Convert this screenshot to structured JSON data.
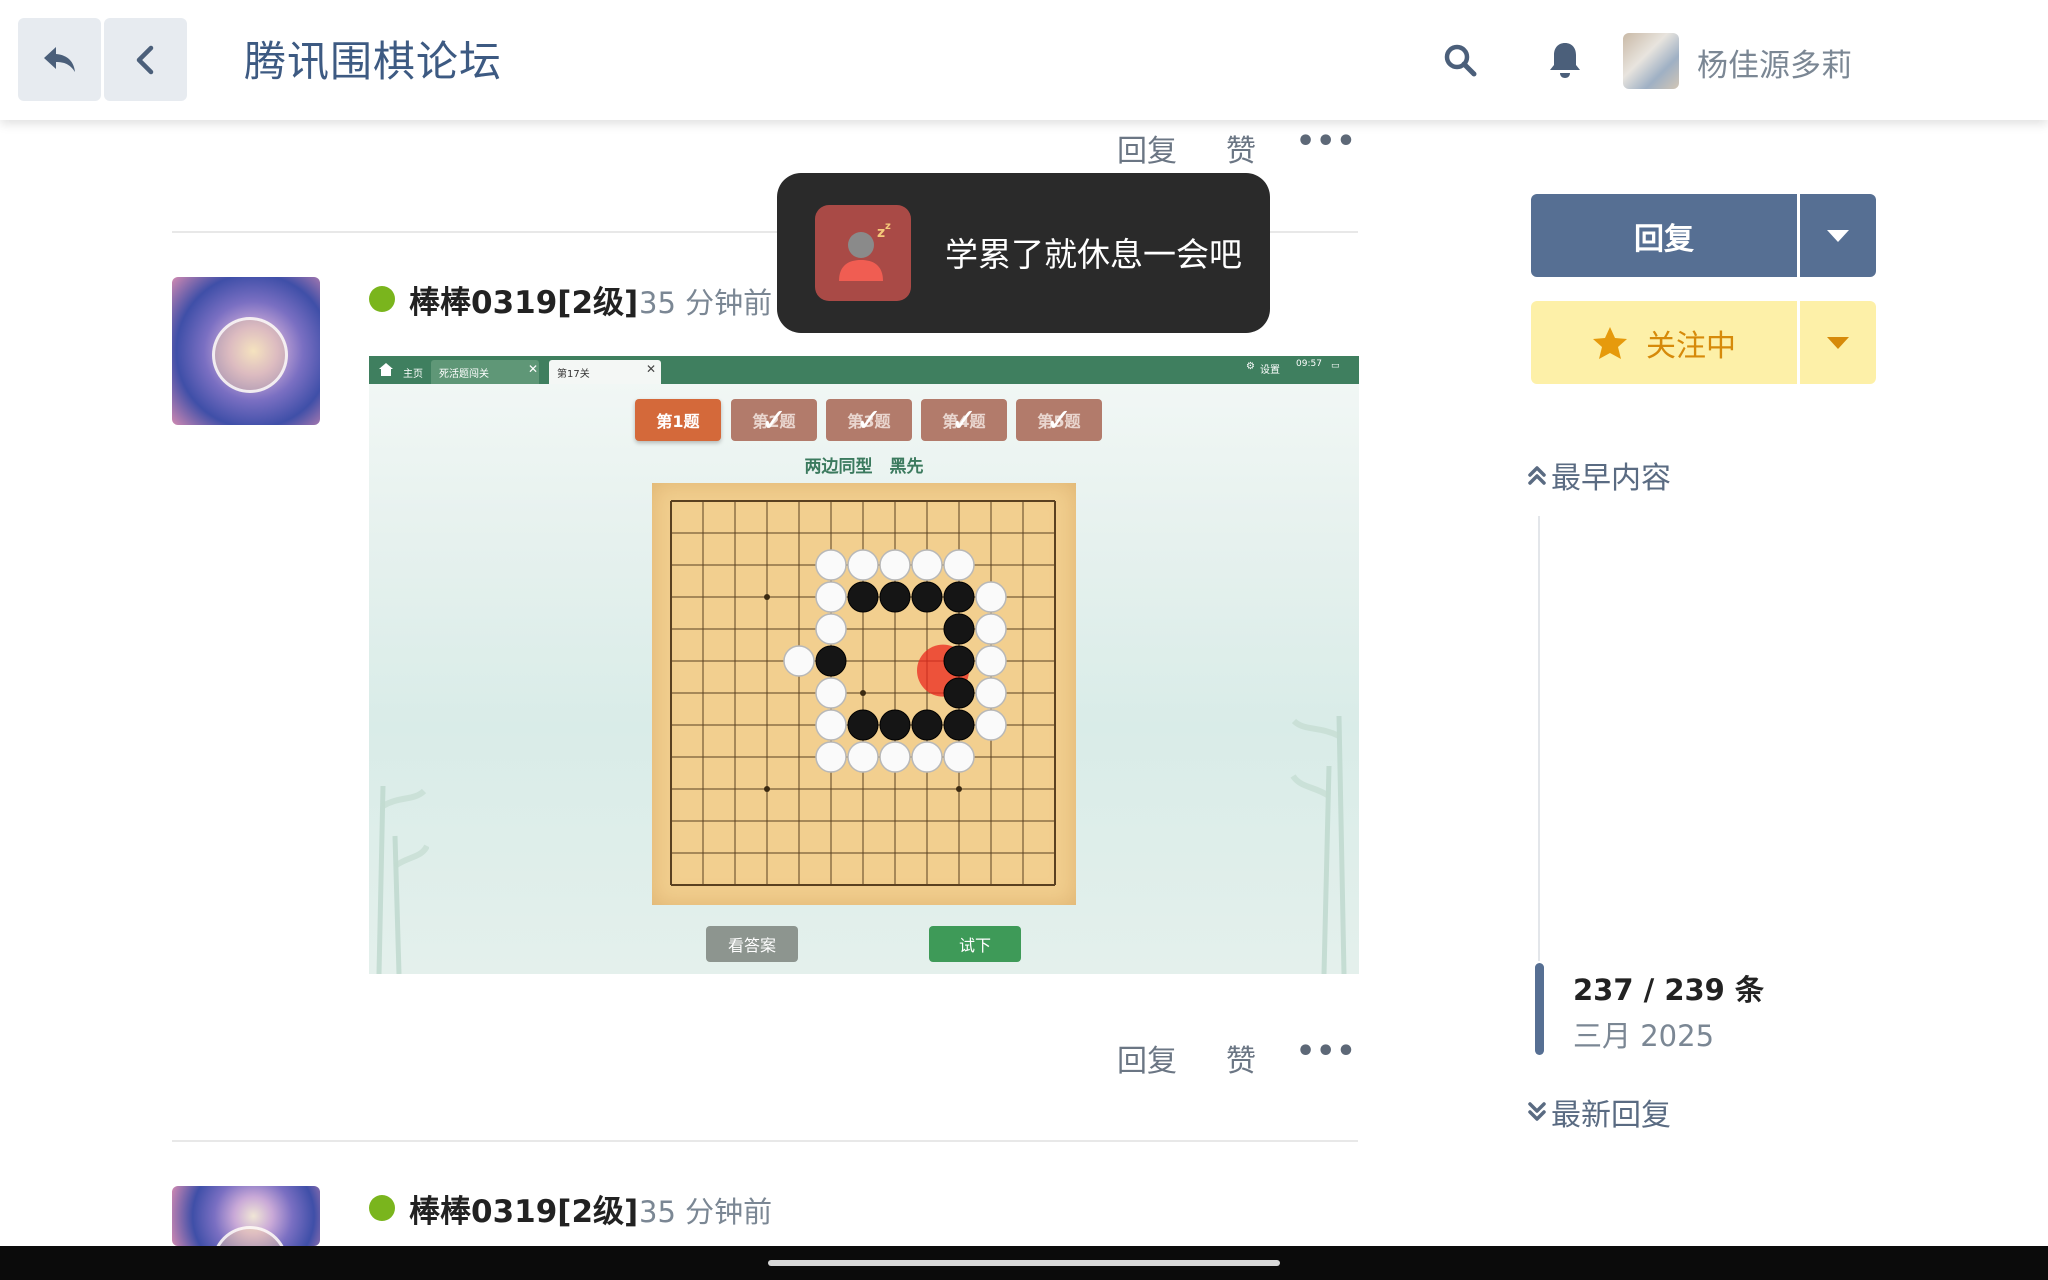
{
  "header": {
    "title": "腾讯围棋论坛",
    "username": "杨佳源多莉",
    "icons": {
      "back": "reply-arrow-icon",
      "prev": "chevron-left-icon",
      "search": "search-icon",
      "notifications": "bell-icon"
    }
  },
  "post_actions": {
    "reply": "回复",
    "like": "赞",
    "more": "•••"
  },
  "posts": [
    {
      "username": "棒棒0319[2级]",
      "time": "35 分钟前",
      "image": {
        "tabs": [
          "主页",
          "死活题闯关",
          "第17关"
        ],
        "settings": "设置",
        "clock": "09:57",
        "questions": [
          "第1题",
          "第2题",
          "第3题",
          "第4题",
          "第5题"
        ],
        "subtitle": "两边同型　黑先",
        "buttons": {
          "answer": "看答案",
          "try": "试下"
        },
        "stones": {
          "white": [
            [
              5,
              2
            ],
            [
              6,
              2
            ],
            [
              7,
              2
            ],
            [
              8,
              2
            ],
            [
              9,
              2
            ],
            [
              5,
              3
            ],
            [
              10,
              3
            ],
            [
              5,
              4
            ],
            [
              10,
              4
            ],
            [
              4,
              5
            ],
            [
              10,
              5
            ],
            [
              5,
              6
            ],
            [
              10,
              6
            ],
            [
              5,
              7
            ],
            [
              10,
              7
            ],
            [
              5,
              8
            ],
            [
              6,
              8
            ],
            [
              7,
              8
            ],
            [
              8,
              8
            ],
            [
              9,
              8
            ]
          ],
          "black": [
            [
              6,
              3
            ],
            [
              7,
              3
            ],
            [
              8,
              3
            ],
            [
              9,
              3
            ],
            [
              9,
              4
            ],
            [
              5,
              5
            ],
            [
              9,
              5
            ],
            [
              9,
              6
            ],
            [
              6,
              7
            ],
            [
              7,
              7
            ],
            [
              8,
              7
            ],
            [
              9,
              7
            ]
          ],
          "hint": [
            8.5,
            5.3
          ]
        }
      }
    },
    {
      "username": "棒棒0319[2级]",
      "time": "35 分钟前"
    }
  ],
  "toast": {
    "message": "学累了就休息一会吧",
    "icon": "sleeping-user-icon"
  },
  "sidebar": {
    "reply": "回复",
    "follow": "关注中",
    "earliest": "最早内容",
    "latest": "最新回复",
    "progress": "237 / 239 条",
    "date": "三月 2025"
  },
  "colors": {
    "accent": "#566f93",
    "follow_bg": "#fdf0a8",
    "follow_text": "#d68a0a",
    "online": "#7ab51d"
  }
}
